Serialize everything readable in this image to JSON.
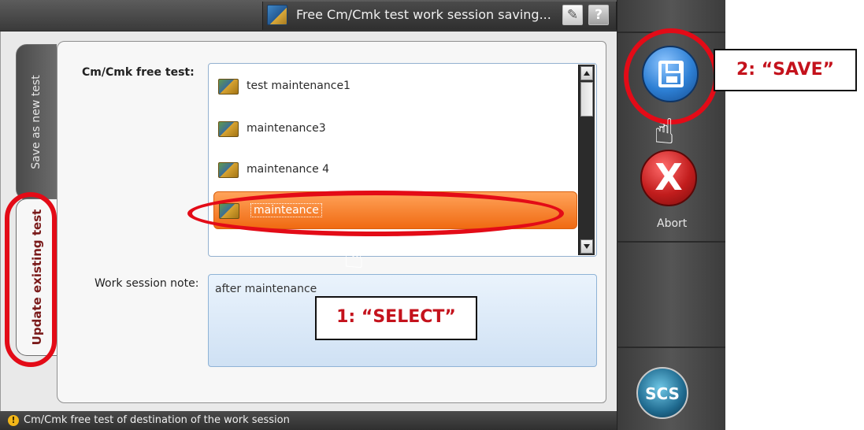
{
  "window": {
    "title": "Free Cm/Cmk test work session saving...",
    "edit_icon": "pencil-icon",
    "help_label": "?"
  },
  "tabs": [
    {
      "label": "Save as new test",
      "active": false
    },
    {
      "label": "Update existing test",
      "active": true
    }
  ],
  "form": {
    "test_label": "Cm/Cmk free test:",
    "note_label": "Work session note:",
    "note_value": "after maintenance"
  },
  "list": {
    "items": [
      {
        "label": "test maintenance1",
        "selected": false
      },
      {
        "label": "maintenance3",
        "selected": false
      },
      {
        "label": "maintenance 4",
        "selected": false
      },
      {
        "label": "mainteance",
        "selected": true
      }
    ]
  },
  "status": {
    "icon": "warning-icon",
    "text": "Cm/Cmk free test of destination of the work session"
  },
  "actions": {
    "save_label": "S",
    "abort_label": "Abort",
    "abort_glyph": "X",
    "logo_text": "SCS"
  },
  "annotations": {
    "select": "1: “SELECT”",
    "save": "2: “SAVE”"
  },
  "colors": {
    "selected_item": "#f07a22",
    "annotation_red": "#e30b17",
    "save_blue": "#2d7fd4",
    "abort_red": "#c21d1d"
  }
}
